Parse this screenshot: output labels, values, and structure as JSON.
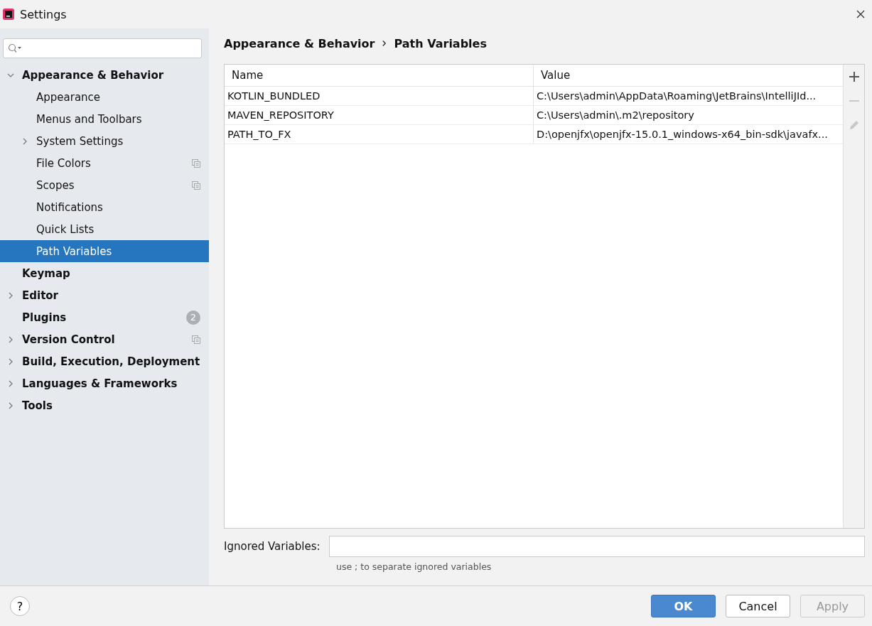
{
  "window": {
    "title": "Settings"
  },
  "sidebar": {
    "items": [
      {
        "label": "Appearance & Behavior",
        "expanded": true,
        "selected": false,
        "children": [
          {
            "label": "Appearance",
            "selected": false
          },
          {
            "label": "Menus and Toolbars",
            "selected": false
          },
          {
            "label": "System Settings",
            "expanded": false,
            "selected": false
          },
          {
            "label": "File Colors",
            "selected": false,
            "project_level": true
          },
          {
            "label": "Scopes",
            "selected": false,
            "project_level": true
          },
          {
            "label": "Notifications",
            "selected": false
          },
          {
            "label": "Quick Lists",
            "selected": false
          },
          {
            "label": "Path Variables",
            "selected": true
          }
        ]
      },
      {
        "label": "Keymap",
        "selected": false
      },
      {
        "label": "Editor",
        "expanded": false,
        "selected": false
      },
      {
        "label": "Plugins",
        "selected": false,
        "badge": "2"
      },
      {
        "label": "Version Control",
        "expanded": false,
        "selected": false,
        "project_level": true
      },
      {
        "label": "Build, Execution, Deployment",
        "expanded": false,
        "selected": false
      },
      {
        "label": "Languages & Frameworks",
        "expanded": false,
        "selected": false
      },
      {
        "label": "Tools",
        "expanded": false,
        "selected": false
      }
    ]
  },
  "breadcrumb": [
    "Appearance & Behavior",
    "Path Variables"
  ],
  "table": {
    "columns": [
      "Name",
      "Value"
    ],
    "rows": [
      {
        "name": "KOTLIN_BUNDLED",
        "value": "C:\\Users\\admin\\AppData\\Roaming\\JetBrains\\IntelliJId..."
      },
      {
        "name": "MAVEN_REPOSITORY",
        "value": "C:\\Users\\admin\\.m2\\repository"
      },
      {
        "name": "PATH_TO_FX",
        "value": "D:\\openjfx\\openjfx-15.0.1_windows-x64_bin-sdk\\javafx..."
      }
    ]
  },
  "toolbar": [
    {
      "kind": "add",
      "disabled": false
    },
    {
      "kind": "remove",
      "disabled": true
    },
    {
      "kind": "edit",
      "disabled": true
    }
  ],
  "ignored": {
    "label": "Ignored Variables:",
    "hint": "use ; to separate ignored variables"
  },
  "footer": {
    "help": "?",
    "buttons": [
      {
        "label": "OK",
        "kind": "primary",
        "disabled": false
      },
      {
        "label": "Cancel",
        "kind": "normal",
        "disabled": false
      },
      {
        "label": "Apply",
        "kind": "normal",
        "disabled": true
      }
    ]
  }
}
